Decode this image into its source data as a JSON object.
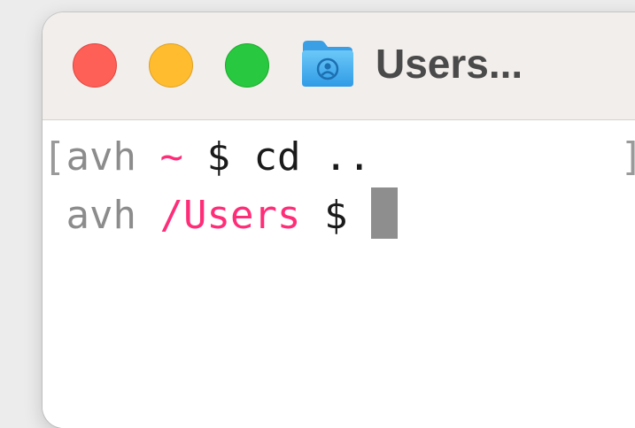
{
  "window": {
    "title": "Users..."
  },
  "titlebar": {
    "buttons": [
      {
        "name": "close",
        "color": "#fe5f57"
      },
      {
        "name": "minimize",
        "color": "#febc2e"
      },
      {
        "name": "zoom",
        "color": "#28c840"
      }
    ],
    "icon": "folder-icon"
  },
  "terminal": {
    "lines": [
      {
        "open_bracket": "[",
        "user": "avh",
        "path": "~",
        "prompt": "$",
        "command": "cd ..",
        "close_bracket": "]"
      },
      {
        "user": "avh",
        "path": "/Users",
        "prompt": "$",
        "command": ""
      }
    ],
    "colors": {
      "user": "#8c8c8c",
      "path": "#ff2d78",
      "text": "#1a1a1a",
      "cursor": "#8e8e8e"
    }
  }
}
